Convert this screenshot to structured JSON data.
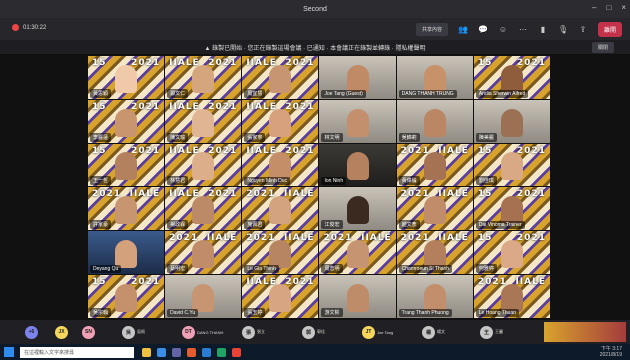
{
  "window": {
    "title": "Second"
  },
  "toolbar": {
    "timer": "01:30:22",
    "pill_label": "共享內容",
    "leave_label": "離開"
  },
  "banner": {
    "text": "▲ 錄製已開始 · 您正在錄製這場會議 · 已通知 · 本會議正在錄製並轉錄 · 隱私權聲明",
    "button": "關閉"
  },
  "tiles": [
    {
      "bg": "banner-bg",
      "text_left": "15",
      "text_right": "2021",
      "label": "黃思穎",
      "head": "#f0c9a8"
    },
    {
      "bg": "banner-bg",
      "text_left": "IIALE",
      "text_right": "2021",
      "label": "鄭文仁",
      "head": "#d5a57e"
    },
    {
      "bg": "banner-bg",
      "text_left": "IIALE",
      "text_right": "2021",
      "label": "周宜慧",
      "head": "#c89572"
    },
    {
      "bg": "room-bg",
      "text_left": "",
      "text_right": "",
      "label": "Joe Tang (Guest)",
      "head": "#c08a66"
    },
    {
      "bg": "room-bg",
      "text_left": "",
      "text_right": "",
      "label": "DANG THANH TRUNG",
      "head": "#c7916a"
    },
    {
      "bg": "banner-bg",
      "text_left": "15",
      "text_right": "2021",
      "label": "Andia Sherwin Alfred",
      "head": "#8f5c3c"
    },
    {
      "bg": "banner-bg",
      "text_left": "15",
      "text_right": "2021",
      "label": "李麗蓮",
      "head": "#c8956f"
    },
    {
      "bg": "banner-bg",
      "text_left": "IIALE",
      "text_right": "2021",
      "label": "陳文瑜",
      "head": "#e0b593"
    },
    {
      "bg": "banner-bg",
      "text_left": "IIALE",
      "text_right": "2021",
      "label": "張家寧",
      "head": "#d6a17c"
    },
    {
      "bg": "room-bg",
      "text_left": "",
      "text_right": "",
      "label": "林文明",
      "head": "#c48f6c"
    },
    {
      "bg": "room-bg",
      "text_left": "",
      "text_right": "",
      "label": "吳錦莉",
      "head": "#bb8664"
    },
    {
      "bg": "room-bg",
      "text_left": "",
      "text_right": "",
      "label": "陳美麗",
      "head": "#9c7052"
    },
    {
      "bg": "banner-bg",
      "text_left": "15",
      "text_right": "2021",
      "label": "王一哲",
      "head": "#b3815d"
    },
    {
      "bg": "banner-bg",
      "text_left": "IIALE",
      "text_right": "2021",
      "label": "林慧君",
      "head": "#dcae8a"
    },
    {
      "bg": "banner-bg",
      "text_left": "IIALE",
      "text_right": "2021",
      "label": "Nguyen Minh Duc",
      "head": "#c48e69"
    },
    {
      "bg": "dark-bg",
      "text_left": "",
      "text_right": "",
      "label": "Ion Ninh",
      "head": "#b5815f"
    },
    {
      "bg": "banner-bg",
      "text_left": "2021",
      "text_right": "IIALE",
      "label": "黃偉倫",
      "head": "#a57354"
    },
    {
      "bg": "banner-bg",
      "text_left": "15",
      "text_right": "2021",
      "label": "劉佳琪",
      "head": "#d9a985"
    },
    {
      "bg": "banner-bg",
      "text_left": "2021",
      "text_right": "IIALE",
      "label": "許家豪",
      "head": "#c89571"
    },
    {
      "bg": "banner-bg",
      "text_left": "IIALE",
      "text_right": "2021",
      "label": "楊政霖",
      "head": "#bd8a67"
    },
    {
      "bg": "banner-bg",
      "text_left": "2021",
      "text_right": "IIALE",
      "label": "施佩君",
      "head": "#d3a27f"
    },
    {
      "bg": "room-bg",
      "text_left": "",
      "text_right": "",
      "label": "江俊宏",
      "head": "#3a2a20"
    },
    {
      "bg": "banner-bg",
      "text_left": "2021",
      "text_right": "IIALE",
      "label": "趙文彥",
      "head": "#c18c69"
    },
    {
      "bg": "banner-bg",
      "text_left": "15",
      "text_right": "2021",
      "label": "Dai Vinoma Trainer",
      "head": "#a67150"
    },
    {
      "bg": "blue-bg",
      "text_left": "",
      "text_right": "",
      "label": "Deyang Qu",
      "head": "#d4a17d"
    },
    {
      "bg": "banner-bg",
      "text_left": "2021",
      "text_right": "IIALE",
      "label": "蔡明宏",
      "head": "#c18c6a"
    },
    {
      "bg": "banner-bg",
      "text_left": "2021",
      "text_right": "IIALE",
      "label": "Le Gia Thinh",
      "head": "#b88563"
    },
    {
      "bg": "banner-bg",
      "text_left": "2021",
      "text_right": "IIALE",
      "label": "周志明",
      "head": "#c69470"
    },
    {
      "bg": "banner-bg",
      "text_left": "2021",
      "text_right": "IIALE",
      "label": "Chamroeun Si Thanh",
      "head": "#b47f5c"
    },
    {
      "bg": "banner-bg",
      "text_left": "15",
      "text_right": "2021",
      "label": "何雅婷",
      "head": "#dba987"
    },
    {
      "bg": "banner-bg",
      "text_left": "15",
      "text_right": "2021",
      "label": "吳宗翰",
      "head": "#c5916d"
    },
    {
      "bg": "room-bg",
      "text_left": "",
      "text_right": "",
      "label": "David C.Yu",
      "head": "#c79572"
    },
    {
      "bg": "banner-bg",
      "text_left": "IIALE",
      "text_right": "2021",
      "label": "張玉婷",
      "head": "#d7a582"
    },
    {
      "bg": "room-bg",
      "text_left": "",
      "text_right": "",
      "label": "游文彬",
      "head": "#bf8c69"
    },
    {
      "bg": "room-bg",
      "text_left": "",
      "text_right": "",
      "label": "Trang Thanh Phuong",
      "head": "#c38e6b"
    },
    {
      "bg": "banner-bg",
      "text_left": "2021",
      "text_right": "IIALE",
      "label": "Le Hoang Thuan",
      "head": "#a97756"
    }
  ],
  "bottom_thumbs": [
    {
      "initials": "+6",
      "color": "#7b83eb",
      "name": ""
    },
    {
      "initials": "JX",
      "color": "#f5d75c",
      "name": ""
    },
    {
      "initials": "SN",
      "color": "#f0a0b5",
      "name": ""
    },
    {
      "initials": "吳",
      "color": "#c6c6c6",
      "name": "吳佩"
    },
    {
      "initials": "DT",
      "color": "#f0a0b5",
      "name": "DANG THANH"
    },
    {
      "initials": "張",
      "color": "#c6c6c6",
      "name": "張立"
    },
    {
      "initials": "郭",
      "color": "#c6c6c6",
      "name": "郭佳"
    },
    {
      "initials": "JT",
      "color": "#f5d75c",
      "name": "Joe Tang"
    },
    {
      "initials": "楊",
      "color": "#c6c6c6",
      "name": "楊文"
    },
    {
      "initials": "王",
      "color": "#c6c6c6",
      "name": "王麗"
    }
  ],
  "taskbar": {
    "search_placeholder": "在這裡輸入文字來搜尋",
    "time": "下午 3:17",
    "date": "2021/8/19"
  },
  "icons": {
    "close": "×",
    "minimize": "–",
    "maximize": "□"
  }
}
